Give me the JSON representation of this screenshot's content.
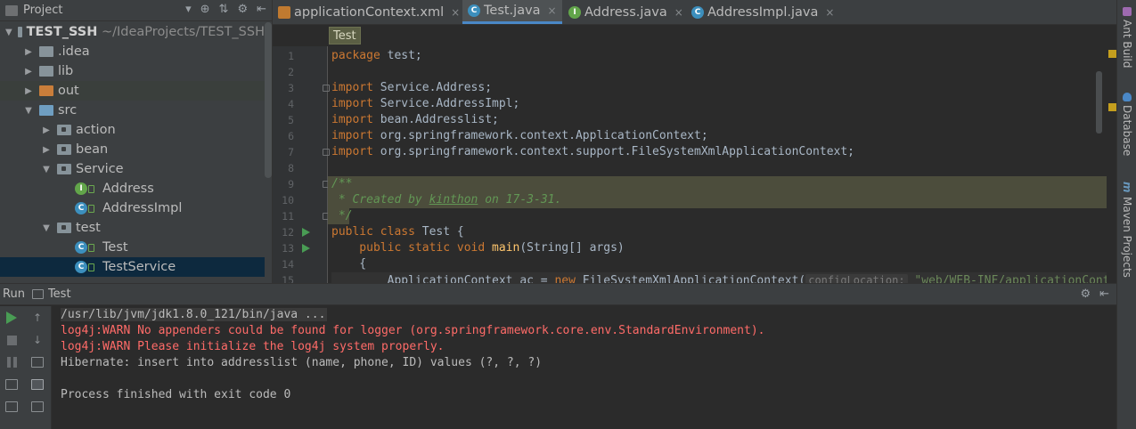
{
  "project_panel": {
    "title": "Project",
    "tools": [
      "▾",
      "⊕",
      "⇅",
      "⚙",
      "⇤"
    ],
    "tree": [
      {
        "label": "TEST_SSH",
        "path": "~/IdeaProjects/TEST_SSH",
        "indent": 0,
        "arrow": "▼",
        "icon": "folder-grey",
        "icon_name": "module-folder-icon"
      },
      {
        "label": ".idea",
        "indent": 1,
        "arrow": "▶",
        "icon": "folder-grey",
        "icon_name": "folder-icon"
      },
      {
        "label": "lib",
        "indent": 1,
        "arrow": "▶",
        "icon": "folder-grey",
        "icon_name": "folder-icon"
      },
      {
        "label": "out",
        "indent": 1,
        "arrow": "▶",
        "icon": "folder-orange",
        "icon_name": "excluded-folder-icon",
        "highlight": true
      },
      {
        "label": "src",
        "indent": 1,
        "arrow": "▼",
        "icon": "folder-blue",
        "icon_name": "source-folder-icon"
      },
      {
        "label": "action",
        "indent": 2,
        "arrow": "▶",
        "icon": "package",
        "icon_name": "package-icon"
      },
      {
        "label": "bean",
        "indent": 2,
        "arrow": "▶",
        "icon": "package",
        "icon_name": "package-icon"
      },
      {
        "label": "Service",
        "indent": 2,
        "arrow": "▼",
        "icon": "package",
        "icon_name": "package-icon"
      },
      {
        "label": "Address",
        "indent": 3,
        "arrow": "",
        "icon": "interface",
        "icon_name": "interface-icon"
      },
      {
        "label": "AddressImpl",
        "indent": 3,
        "arrow": "",
        "icon": "class",
        "icon_name": "class-icon"
      },
      {
        "label": "test",
        "indent": 2,
        "arrow": "▼",
        "icon": "package",
        "icon_name": "package-icon"
      },
      {
        "label": "Test",
        "indent": 3,
        "arrow": "",
        "icon": "class-run",
        "icon_name": "runnable-class-icon"
      },
      {
        "label": "TestService",
        "indent": 3,
        "arrow": "",
        "icon": "class-run",
        "icon_name": "runnable-class-icon",
        "selected": true
      }
    ]
  },
  "editor": {
    "tabs": [
      {
        "label": "applicationContext.xml",
        "icon": "xml",
        "active": false
      },
      {
        "label": "Test.java",
        "icon": "c",
        "active": true
      },
      {
        "label": "Address.java",
        "icon": "i",
        "active": false
      },
      {
        "label": "AddressImpl.java",
        "icon": "c",
        "active": false
      }
    ],
    "tab_close_glyph": "×",
    "breadcrumb": "Test",
    "line_numbers": [
      "1",
      "2",
      "3",
      "4",
      "5",
      "6",
      "7",
      "8",
      "9",
      "10",
      "11",
      "12",
      "13",
      "14",
      "15"
    ],
    "code": {
      "l1_kw": "package",
      "l1_rest": " test;",
      "import_kw": "import",
      "l3": " Service.Address;",
      "l4": " Service.AddressImpl;",
      "l5": " bean.Addresslist;",
      "l6": " org.springframework.context.ApplicationContext;",
      "l7": " org.springframework.context.support.FileSystemXmlApplicationContext;",
      "l9": "/**",
      "l10_a": " * Created by ",
      "l10_user": "kinthon",
      "l10_b": " on 17-3-31.",
      "l11": " */",
      "l12_kw": "public class",
      "l12_rest": " Test {",
      "l13_kw": "    public static void",
      "l13_fn": " main",
      "l13_rest": "(String[] args)",
      "l14": "    {",
      "l15_a": "        ApplicationContext ac = ",
      "l15_kw": "new",
      "l15_b": " FileSystemXmlApplicationContext(",
      "l15_hint": "configLocation:",
      "l15_str": " \"web/WEB-INF/applicationConte"
    }
  },
  "right_strip": {
    "tabs": [
      "Ant Build",
      "Database",
      "Maven Projects"
    ]
  },
  "run_panel": {
    "title": "Run",
    "tab": "Test",
    "tools": [
      "⚙",
      "⇤"
    ],
    "console": [
      {
        "text": "/usr/lib/jvm/jdk1.8.0_121/bin/java ...",
        "kind": "cmd"
      },
      {
        "text": "log4j:WARN No appenders could be found for logger (org.springframework.core.env.StandardEnvironment).",
        "kind": "err"
      },
      {
        "text": "log4j:WARN Please initialize the log4j system properly.",
        "kind": "err"
      },
      {
        "text": "Hibernate: insert into addresslist (name, phone, ID) values (?, ?, ?)",
        "kind": "out"
      },
      {
        "text": "",
        "kind": "out"
      },
      {
        "text": "Process finished with exit code 0",
        "kind": "out"
      }
    ]
  },
  "colors": {
    "background": "#2b2b2b",
    "panel": "#3c3f41",
    "selection": "#0d293e",
    "keyword": "#cc7832",
    "doc_comment": "#629755",
    "error_text": "#ff6b68"
  }
}
